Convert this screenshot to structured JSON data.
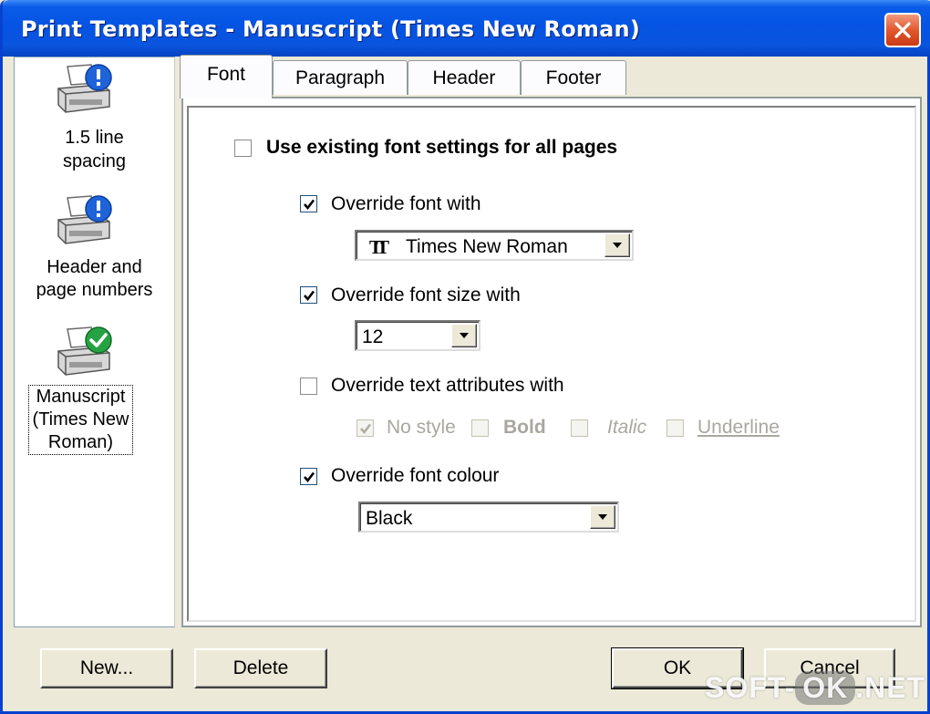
{
  "window": {
    "title": "Print Templates - Manuscript (Times New Roman)"
  },
  "templates": [
    {
      "label_lines": [
        "1.5 line",
        "spacing"
      ],
      "icon": "printer-info-icon"
    },
    {
      "label_lines": [
        "Header and",
        "page numbers"
      ],
      "icon": "printer-info-icon"
    },
    {
      "label_lines": [
        "Manuscript",
        "(Times New",
        "Roman)"
      ],
      "icon": "printer-check-icon",
      "selected": true
    }
  ],
  "tabs": [
    "Font",
    "Paragraph",
    "Header",
    "Footer"
  ],
  "font_tab": {
    "use_existing": {
      "label": "Use existing font settings for all pages",
      "checked": false
    },
    "override_font": {
      "label": "Override font with",
      "checked": true,
      "value": "Times New Roman"
    },
    "override_size": {
      "label": "Override font size with",
      "checked": true,
      "value": "12"
    },
    "override_attributes": {
      "label": "Override text attributes with",
      "checked": false,
      "options": {
        "no_style": {
          "label": "No style",
          "checked": true
        },
        "bold": {
          "label": "Bold",
          "checked": false
        },
        "italic": {
          "label": "Italic",
          "checked": false
        },
        "underline": {
          "label": "Underline",
          "checked": false
        }
      }
    },
    "override_colour": {
      "label": "Override font colour",
      "checked": true,
      "value": "Black"
    }
  },
  "buttons": {
    "new": "New...",
    "delete": "Delete",
    "ok": "OK",
    "cancel": "Cancel"
  },
  "watermark": {
    "left": "SOFT-",
    "pill": "OK",
    "right": ".NET"
  },
  "colors": {
    "titlebar": "#0553e3",
    "window_bg": "#ece9d8",
    "close_button": "#e2582e"
  }
}
